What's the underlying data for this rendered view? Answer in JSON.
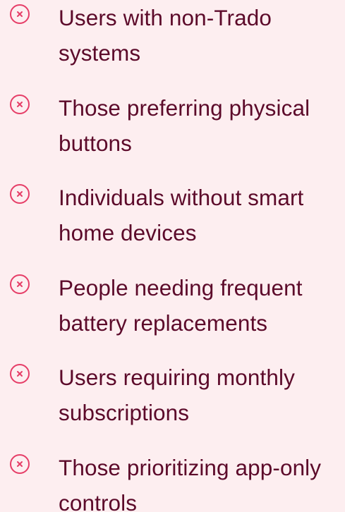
{
  "colors": {
    "background": "#fdeef0",
    "text": "#5c0a2a",
    "icon": "#e63e68"
  },
  "icon_name": "x-circle-icon",
  "items": [
    {
      "label": "Users with non-Trado systems"
    },
    {
      "label": "Those preferring physical buttons"
    },
    {
      "label": "Individuals without smart home devices"
    },
    {
      "label": "People needing frequent battery replacements"
    },
    {
      "label": "Users requiring monthly subscriptions"
    },
    {
      "label": "Those prioritizing app-only controls"
    }
  ]
}
